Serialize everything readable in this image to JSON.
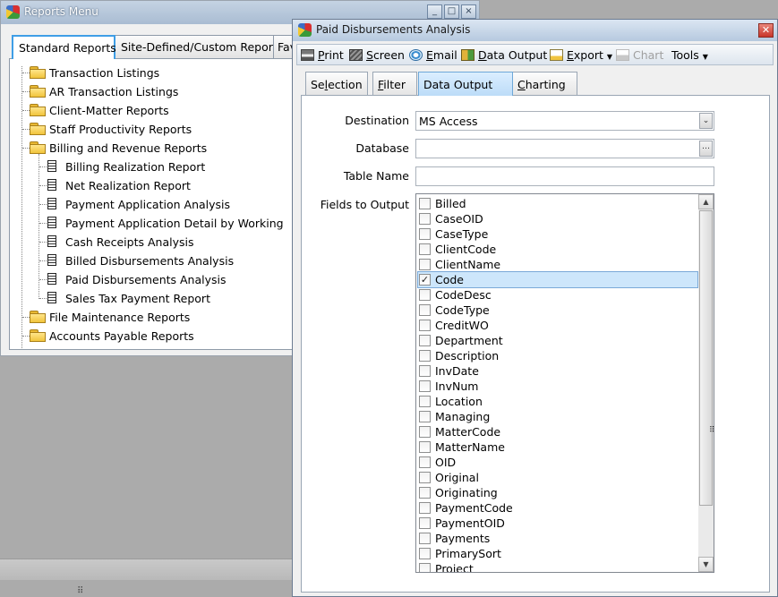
{
  "reports_window": {
    "title": "Reports Menu",
    "tabs": [
      {
        "label": "Standard Reports"
      },
      {
        "label": "Site-Defined/Custom Reports"
      },
      {
        "label": "Fav"
      }
    ],
    "tree": [
      {
        "label": "Transaction Listings",
        "type": "folder",
        "level": 0
      },
      {
        "label": "AR Transaction Listings",
        "type": "folder",
        "level": 0
      },
      {
        "label": "Client-Matter Reports",
        "type": "folder",
        "level": 0
      },
      {
        "label": "Staff Productivity Reports",
        "type": "folder",
        "level": 0
      },
      {
        "label": "Billing and Revenue Reports",
        "type": "folder-open",
        "level": 0
      },
      {
        "label": "Billing Realization Report",
        "type": "doc",
        "level": 1
      },
      {
        "label": "Net Realization Report",
        "type": "doc",
        "level": 1
      },
      {
        "label": "Payment Application Analysis",
        "type": "doc",
        "level": 1
      },
      {
        "label": "Payment Application Detail by Working",
        "type": "doc",
        "level": 1
      },
      {
        "label": "Cash Receipts Analysis",
        "type": "doc",
        "level": 1
      },
      {
        "label": "Billed Disbursements Analysis",
        "type": "doc",
        "level": 1
      },
      {
        "label": "Paid Disbursements Analysis",
        "type": "doc",
        "level": 1
      },
      {
        "label": "Sales Tax Payment Report",
        "type": "doc",
        "level": 1
      },
      {
        "label": "File Maintenance Reports",
        "type": "folder",
        "level": 0
      },
      {
        "label": "Accounts Payable Reports",
        "type": "folder",
        "level": 0
      }
    ]
  },
  "paid_window": {
    "title": "Paid Disbursements Analysis",
    "toolbar": {
      "print": {
        "u": "P",
        "rest": "rint"
      },
      "screen": {
        "u": "S",
        "rest": "creen"
      },
      "email": {
        "u": "E",
        "rest": "mail"
      },
      "data_output": {
        "u": "D",
        "rest": "ata Output"
      },
      "export": {
        "u": "E",
        "rest": "xport"
      },
      "chart": {
        "u": "",
        "rest": "Chart"
      },
      "tools": {
        "u": "",
        "rest": "Tools"
      }
    },
    "tabs": [
      {
        "pre": "Se",
        "u": "l",
        "post": "ection"
      },
      {
        "pre": "",
        "u": "F",
        "post": "ilter"
      },
      {
        "pre": "Data Output",
        "u": "",
        "post": ""
      },
      {
        "pre": "",
        "u": "C",
        "post": "harting"
      }
    ],
    "form": {
      "destination_label": "Destination",
      "destination_value": "MS Access",
      "database_label": "Database",
      "database_value": "",
      "table_name_label": "Table Name",
      "table_name_value": "",
      "fields_label": "Fields to Output"
    },
    "fields": [
      {
        "name": "Billed",
        "checked": false,
        "selected": false
      },
      {
        "name": "CaseOID",
        "checked": false,
        "selected": false
      },
      {
        "name": "CaseType",
        "checked": false,
        "selected": false
      },
      {
        "name": "ClientCode",
        "checked": false,
        "selected": false
      },
      {
        "name": "ClientName",
        "checked": false,
        "selected": false
      },
      {
        "name": "Code",
        "checked": true,
        "selected": true
      },
      {
        "name": "CodeDesc",
        "checked": false,
        "selected": false
      },
      {
        "name": "CodeType",
        "checked": false,
        "selected": false
      },
      {
        "name": "CreditWO",
        "checked": false,
        "selected": false
      },
      {
        "name": "Department",
        "checked": false,
        "selected": false
      },
      {
        "name": "Description",
        "checked": false,
        "selected": false
      },
      {
        "name": "InvDate",
        "checked": false,
        "selected": false
      },
      {
        "name": "InvNum",
        "checked": false,
        "selected": false
      },
      {
        "name": "Location",
        "checked": false,
        "selected": false
      },
      {
        "name": "Managing",
        "checked": false,
        "selected": false
      },
      {
        "name": "MatterCode",
        "checked": false,
        "selected": false
      },
      {
        "name": "MatterName",
        "checked": false,
        "selected": false
      },
      {
        "name": "OID",
        "checked": false,
        "selected": false
      },
      {
        "name": "Original",
        "checked": false,
        "selected": false
      },
      {
        "name": "Originating",
        "checked": false,
        "selected": false
      },
      {
        "name": "PaymentCode",
        "checked": false,
        "selected": false
      },
      {
        "name": "PaymentOID",
        "checked": false,
        "selected": false
      },
      {
        "name": "Payments",
        "checked": false,
        "selected": false
      },
      {
        "name": "PrimarySort",
        "checked": false,
        "selected": false
      },
      {
        "name": "Project",
        "checked": false,
        "selected": false
      }
    ]
  }
}
